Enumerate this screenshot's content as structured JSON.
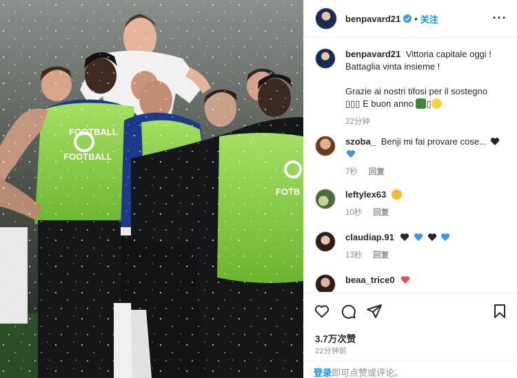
{
  "header": {
    "username": "benpavard21",
    "separator": "•",
    "follow_label": "关注",
    "more_label": "···"
  },
  "caption": {
    "username": "benpavard21",
    "text_1": "Vittoria capitale oggi ! Battaglia vinta insieme !",
    "text_2": "Grazie ai nostri tifosi per il sostegno",
    "text_3": "E buon anno",
    "time": "22分钟"
  },
  "comments": [
    {
      "username": "szoba_",
      "text": "Benji mi fai provare cose...",
      "time": "7秒",
      "reply": "回复",
      "hearts": [
        "#262626",
        "#3897f0"
      ]
    },
    {
      "username": "leftylex63",
      "text": "",
      "time": "10秒",
      "reply": "回复",
      "hearts": []
    },
    {
      "username": "claudiap.91",
      "text": "",
      "time": "13秒",
      "reply": "回复",
      "hearts": [
        "#262626",
        "#3897f0",
        "#262626",
        "#3897f0"
      ]
    },
    {
      "username": "beaa_trice0",
      "text": "",
      "time": "",
      "reply": "",
      "hearts": [
        "#ed4956"
      ]
    }
  ],
  "actions": {
    "icons": [
      "heart-icon",
      "comment-icon",
      "share-icon",
      "bookmark-icon"
    ],
    "likes": "3.7万次赞",
    "posted_ago": "22分钟前",
    "login_link": "登录",
    "login_text": "即可点赞或评论。"
  },
  "colors": {
    "accent": "#0095f6",
    "verified": "#3897f0",
    "vest": "#8fd14f",
    "kit": "#1d3a8a"
  }
}
